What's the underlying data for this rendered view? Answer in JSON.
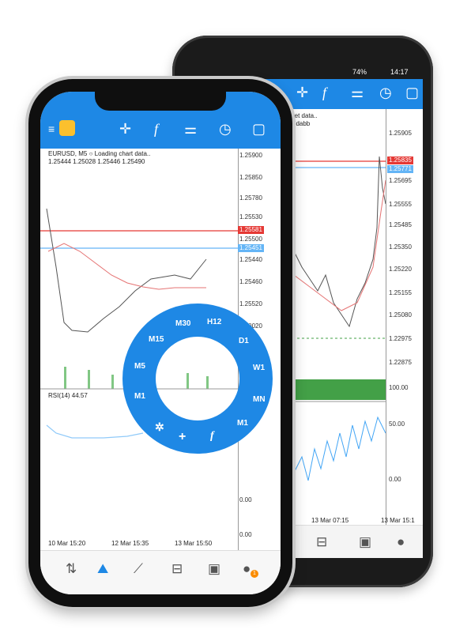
{
  "android": {
    "status": {
      "signal": "74%",
      "time": "14:17"
    },
    "toolbar_icons": [
      "crosshair-icon",
      "function-icon",
      "objects-icon",
      "clock-icon",
      "template-icon"
    ],
    "header_line1": "ret data..",
    "header_line2": "5dabb",
    "prices": [
      "1.25905",
      "1.25835",
      "1.25695",
      "1.25555",
      "1.25485",
      "1.25350",
      "1.25220",
      "1.25155",
      "1.25080",
      "1.22975",
      "1.22875",
      "100.00",
      "50.00",
      "0.00"
    ],
    "bid_badge": "1.25835",
    "ask_badge": "1.25771",
    "time_labels": [
      "13 Mar 07:15",
      "13 Mar 15:1"
    ],
    "bottom_icons": [
      "inbox-icon",
      "news-icon",
      "chat-icon"
    ]
  },
  "iphone": {
    "symbol_line": "EURUSD, M5 ○ Loading chart data..",
    "ohlc_line": "1.25444 1.25028 1.25446 1.25490",
    "prices": [
      "1.25900",
      "1.25850",
      "1.25780",
      "1.25530",
      "1.25500",
      "1.25440",
      "1.25460",
      "1.25520",
      "1.20020",
      "0.00",
      "0.00"
    ],
    "bid_badge": "1.25581",
    "ask_badge": "1.25451",
    "indicator_label": "RSI(14) 44.57",
    "time_labels": [
      "10 Mar 15:20",
      "12 Mar 15:35",
      "13 Mar 15:50"
    ],
    "toolbar_icons": [
      "menu-icon",
      "crosshair-icon",
      "function-icon",
      "objects-icon",
      "clock-icon",
      "template-icon"
    ],
    "bottom_icons": [
      "quotes-icon",
      "chart-icon",
      "trade-icon",
      "history-icon",
      "news-icon",
      "chat-icon"
    ],
    "chat_badge": "1"
  },
  "timeframe_ring": {
    "items": [
      "H12",
      "D1",
      "W1",
      "MN",
      "↑",
      "+",
      "f",
      "M1",
      "M5",
      "M15",
      "M30",
      "H1"
    ]
  },
  "colors": {
    "accent": "#1e88e5",
    "bid": "#e53935",
    "ask": "#64b5f6",
    "volume": "#43a047",
    "rsi": "#42a5f5"
  }
}
